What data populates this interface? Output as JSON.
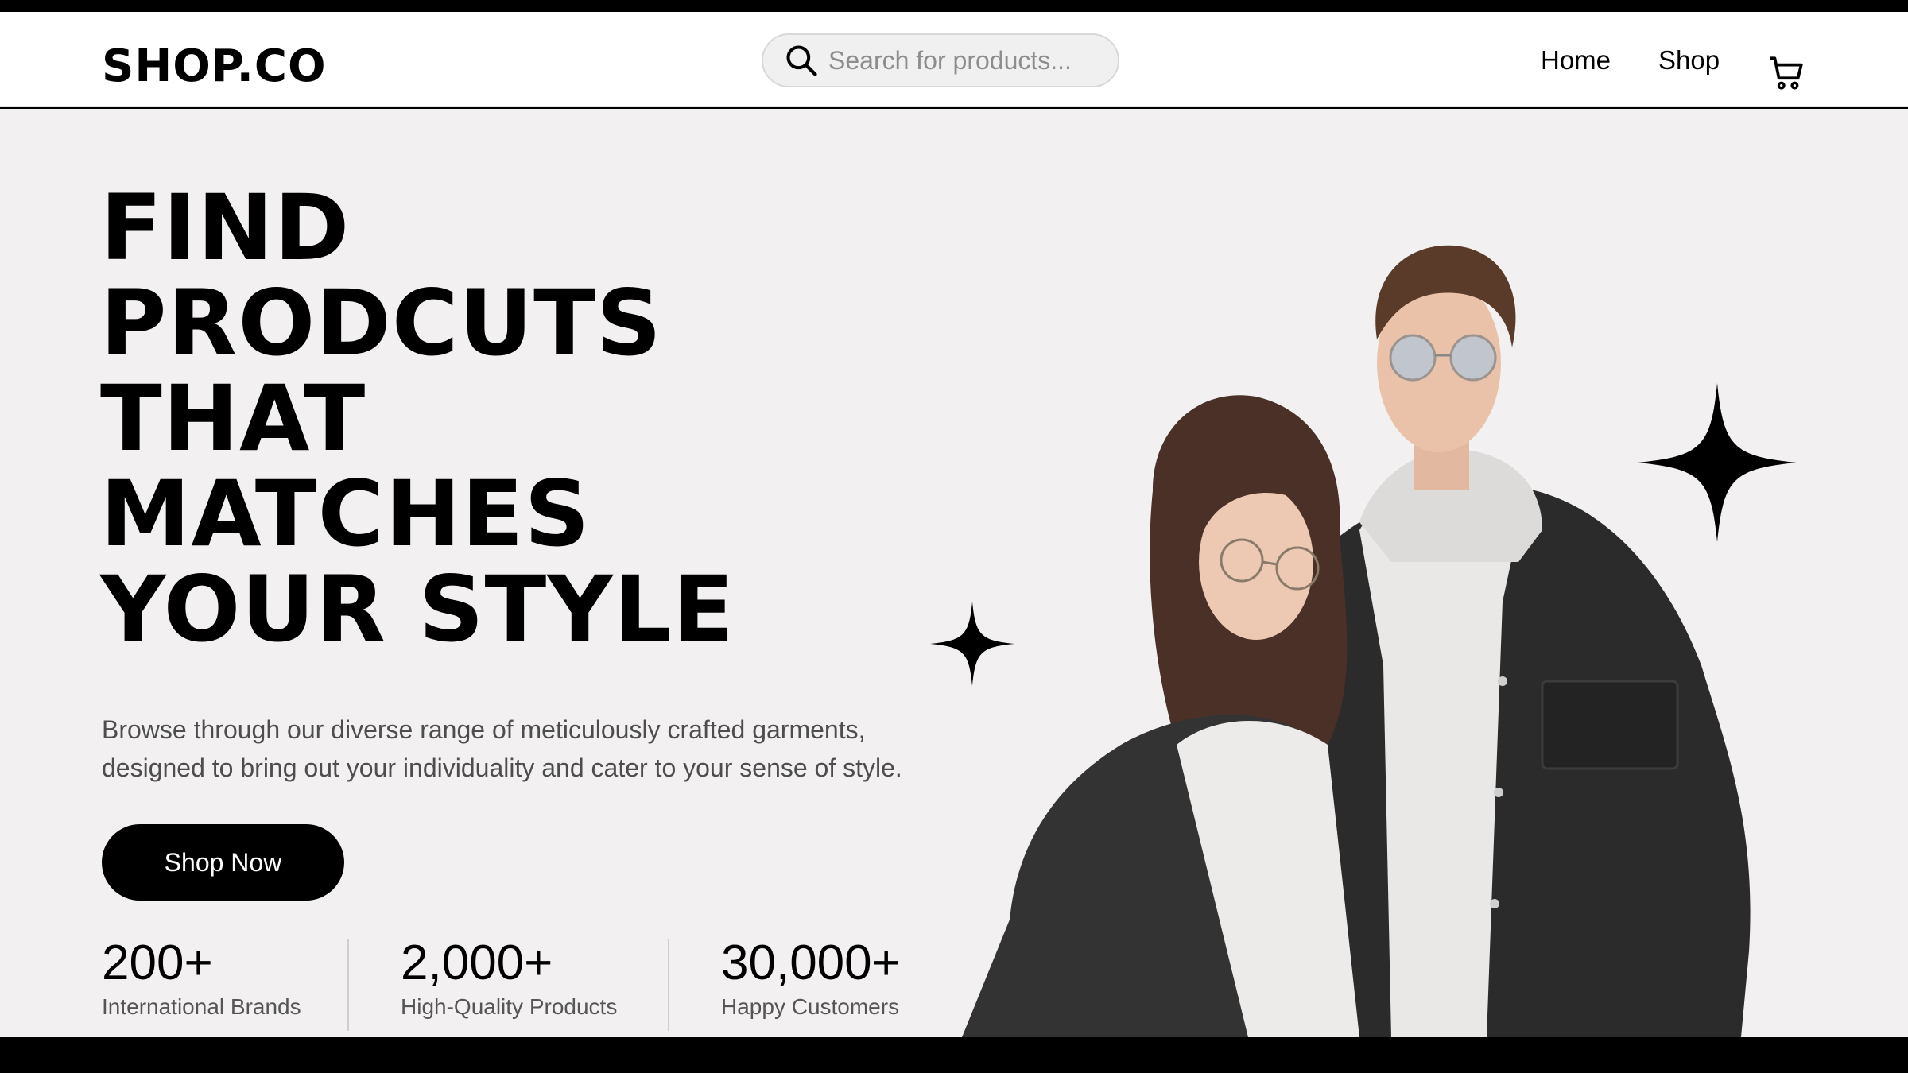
{
  "brand": {
    "logo": "SHOP.CO"
  },
  "search": {
    "placeholder": "Search for products..."
  },
  "nav": {
    "home": "Home",
    "shop": "Shop"
  },
  "hero": {
    "headline": [
      "FIND",
      "PRODCUTS",
      "THAT",
      "MATCHES",
      "YOUR STYLE"
    ],
    "subtitle_line1": "Browse through our diverse range of meticulously crafted garments,",
    "subtitle_line2": "designed to bring out your individuality and cater to your sense of style.",
    "cta": "Shop Now"
  },
  "stats": [
    {
      "value": "200+",
      "label": "International Brands"
    },
    {
      "value": "2,000+",
      "label": "High-Quality Products"
    },
    {
      "value": "30,000+",
      "label": "Happy Customers"
    }
  ],
  "icons": {
    "search": "search-icon",
    "cart": "cart-icon",
    "sparkle": "sparkle-icon"
  },
  "colors": {
    "hero_background": "#f2f0f1",
    "primary": "#000000",
    "muted_text": "#4d4d4d"
  }
}
